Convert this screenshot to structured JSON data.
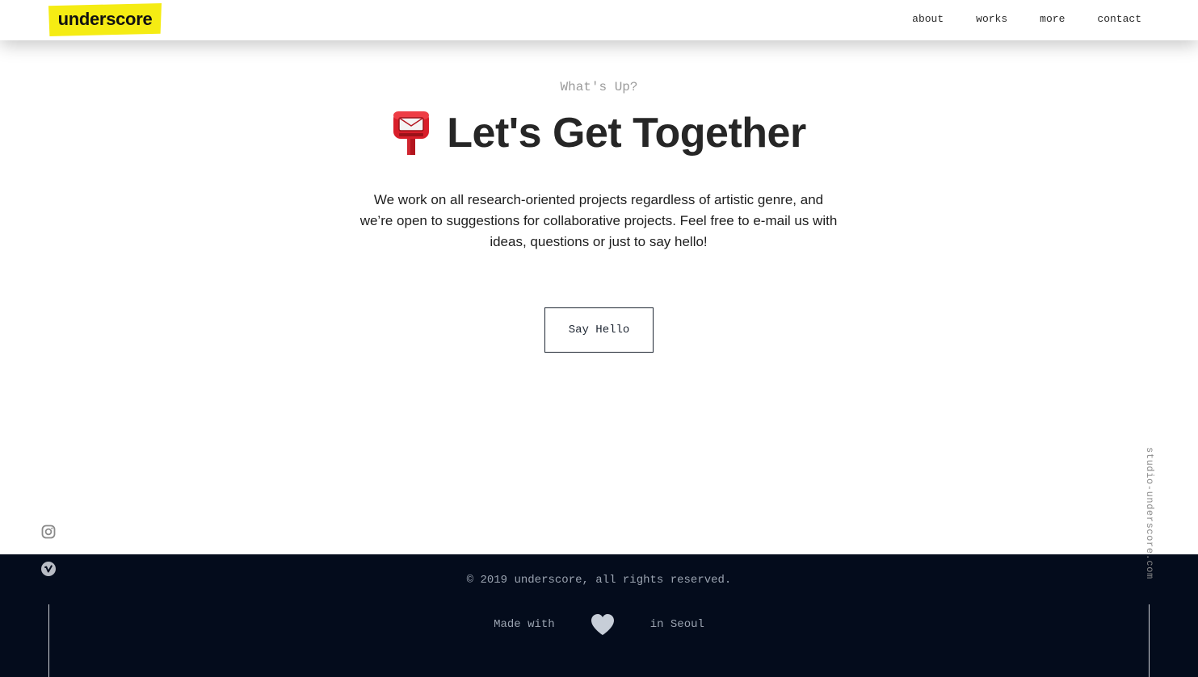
{
  "header": {
    "logo_text": "underscore",
    "logo_color": "#f5ec13",
    "nav": [
      {
        "label": "about"
      },
      {
        "label": "works"
      },
      {
        "label": "more"
      },
      {
        "label": "contact"
      }
    ]
  },
  "main": {
    "eyebrow": "What's Up?",
    "title_icon": "postbox-icon",
    "title": "Let's Get Together",
    "intro": "We work on all research-oriented projects regardless of artistic genre, and we’re open to suggestions for collaborative projects. Feel free to e-mail us with ideas, questions or just to say hello!",
    "cta_label": "Say Hello"
  },
  "social": [
    {
      "icon": "instagram-icon"
    },
    {
      "icon": "vimeo-icon"
    }
  ],
  "side_text": "studio-underscore.com",
  "footer": {
    "background": "#040c1c",
    "copyright": "© 2019 underscore, all rights reserved.",
    "made_with_prefix": "Made with",
    "heart_icon": "heart-icon",
    "made_with_suffix": "in Seoul"
  }
}
